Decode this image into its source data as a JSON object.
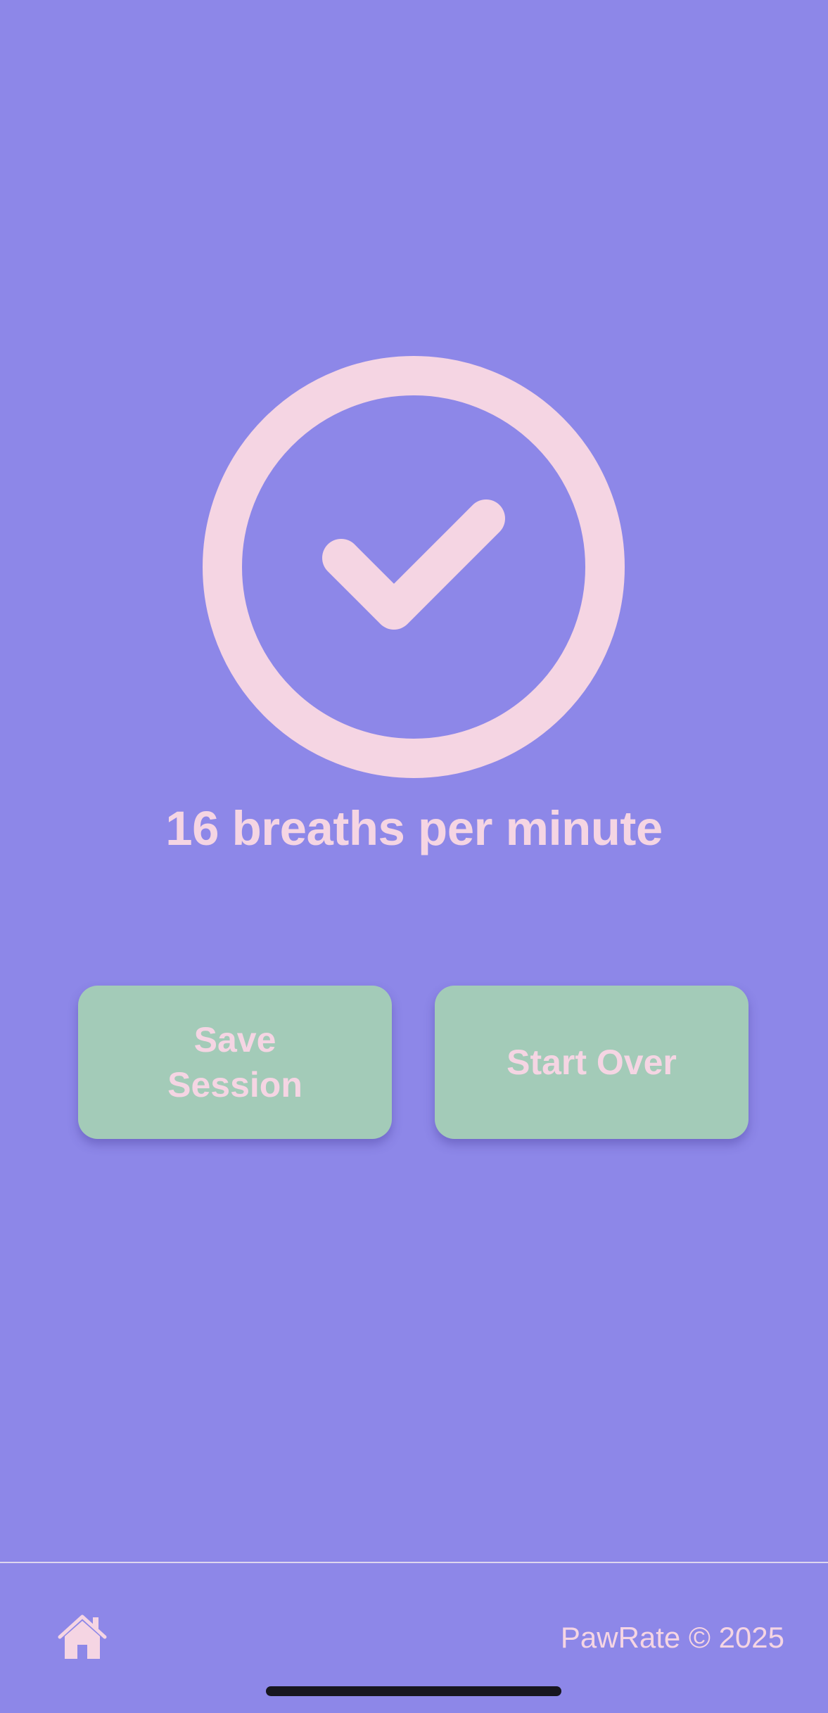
{
  "result": {
    "breath_rate_text": "16 breaths per minute"
  },
  "actions": {
    "save_label": "Save Session",
    "start_over_label": "Start Over"
  },
  "footer": {
    "copyright": "PawRate © 2025",
    "home_icon": "home-icon"
  },
  "colors": {
    "background": "#8d87e8",
    "accent_pink": "#f5d5e3",
    "button_green": "#a3cbb8"
  },
  "icons": {
    "success": "check-circle-icon"
  }
}
